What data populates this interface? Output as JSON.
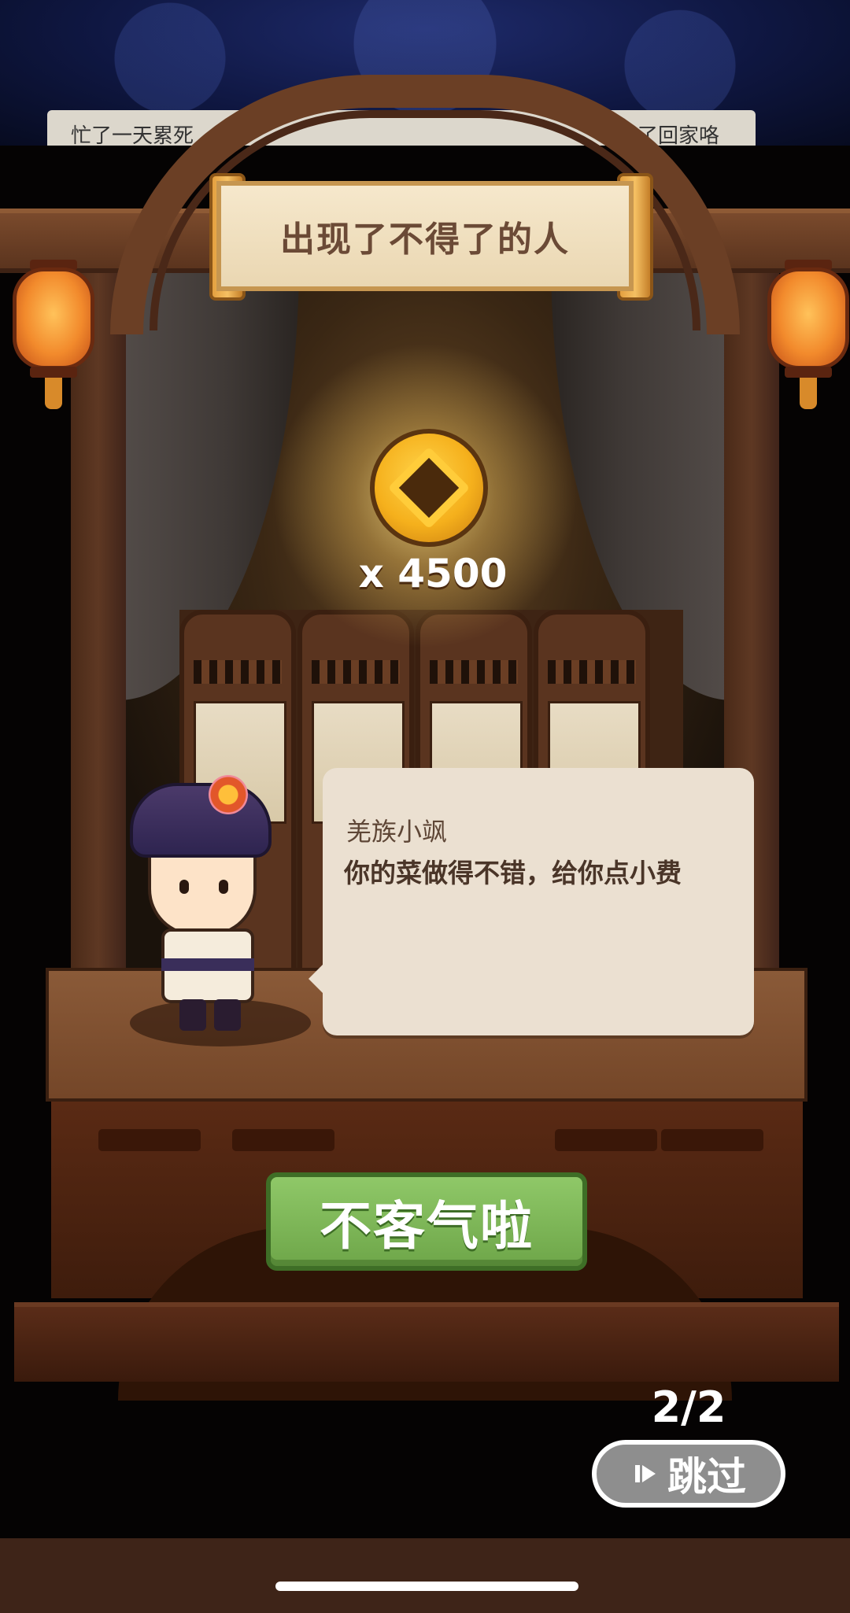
{
  "background_banner": {
    "left_text": "忙了一天累死",
    "right_text": "了回家咯"
  },
  "event": {
    "title": "出现了不得了的人"
  },
  "reward": {
    "icon": "coin-icon",
    "amount_text": "x 4500"
  },
  "dialogue": {
    "speaker": "羌族小飒",
    "text": "你的菜做得不错，给你点小费"
  },
  "actions": {
    "confirm_label": "不客气啦",
    "skip_label": "跳过"
  },
  "progress": {
    "page_text": "2/2"
  },
  "colors": {
    "confirm_green": "#7bb456",
    "bubble_bg": "#ebe0d1",
    "wood": "#6b3f25",
    "skip_bg": "#8e8e8e"
  }
}
